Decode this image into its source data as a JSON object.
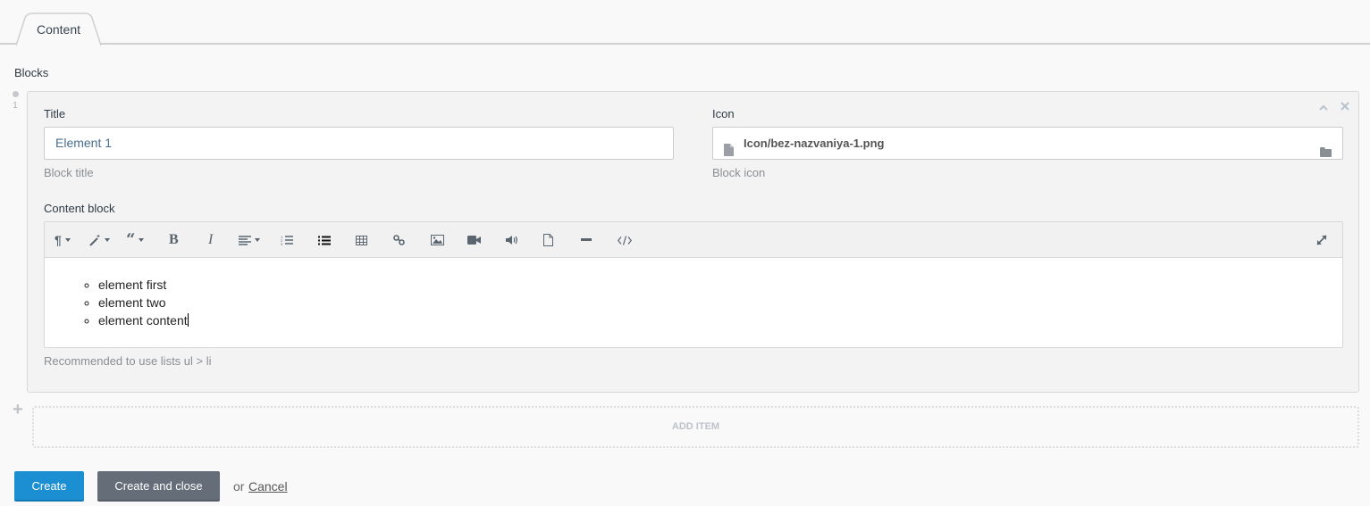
{
  "tabs": [
    {
      "label": "Content",
      "active": true
    }
  ],
  "section": {
    "label": "Blocks"
  },
  "blocks": [
    {
      "index": "1",
      "title_field": {
        "label": "Title",
        "value": "Element 1",
        "hint": "Block title"
      },
      "icon_field": {
        "label": "Icon",
        "value": "Icon/bez-nazvaniya-1.png",
        "hint": "Block icon"
      },
      "content_field": {
        "label": "Content block",
        "toolbar": [
          "paragraph-style",
          "text-style",
          "quote",
          "bold",
          "italic",
          "align",
          "ordered-list",
          "unordered-list",
          "table",
          "link",
          "image",
          "video",
          "audio",
          "file",
          "horizontal-rule",
          "code-view",
          "fullscreen"
        ],
        "list_items": [
          "element first",
          "element two",
          "element content"
        ],
        "hint": "Recommended to use lists ul > li"
      }
    }
  ],
  "add_item": {
    "label": "ADD ITEM"
  },
  "actions": {
    "create_label": "Create",
    "create_close_label": "Create and close",
    "or_text": "or",
    "cancel_label": "Cancel"
  },
  "colors": {
    "primary": "#1b8fd2",
    "secondary": "#656d78"
  }
}
